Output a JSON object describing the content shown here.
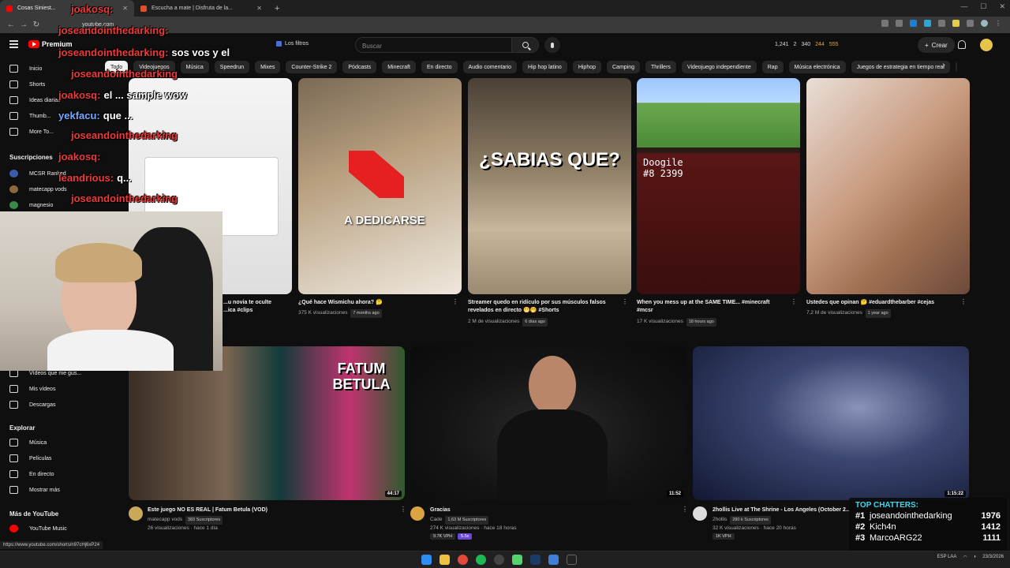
{
  "browser": {
    "tabs": [
      {
        "label": "Cosas Siniest...",
        "active": true
      },
      {
        "label": "Escucha a mate | Disfruta de la...",
        "active": false
      }
    ],
    "new_tab": "+",
    "url": "youtube.com",
    "status_url": "https://www.youtube.com/shorts/n97cHj6xP24"
  },
  "header": {
    "logo_text": "Premium",
    "filters_label": "Los filtros",
    "search_placeholder": "Buscar",
    "stats": [
      "1,241",
      "2",
      "340",
      "244",
      "555"
    ],
    "create_label": "Crear"
  },
  "chips": [
    "Todo",
    "Videojuegos",
    "Música",
    "Speedrun",
    "Mixes",
    "Counter-Strike 2",
    "Pódcasts",
    "Minecraft",
    "En directo",
    "Audio comentario",
    "Hip hop latino",
    "Hiphop",
    "Camping",
    "Thrillers",
    "Videojuego independiente",
    "Rap",
    "Música electrónica",
    "Juegos de estrategia en tiempo real",
    "Subid"
  ],
  "sidebar": {
    "items": [
      "Inicio",
      "Shorts",
      "Ideas diarias",
      "Thumb...",
      "More To..."
    ],
    "subs_header": "Suscripciones",
    "subs": [
      "MCSR Ranked",
      "matecapp vods",
      "magnesio"
    ],
    "you_items": [
      "Vídeos que me gus...",
      "Mis vídeos",
      "Descargas"
    ],
    "explore_header": "Explorar",
    "explore_items": [
      "Música",
      "Películas",
      "En directo",
      "Mostrar más"
    ],
    "more_header": "Más de YouTube",
    "more_items": [
      "YouTube Music"
    ]
  },
  "shorts": [
    {
      "title": "...u novia te oculte\n...ica #clips",
      "meta": ""
    },
    {
      "title": "¿Qué hace Wismichu ahora? 🤔",
      "views": "375 K visualizaciones",
      "age": "7 months ago",
      "overlay": "A DEDICARSE"
    },
    {
      "title": "Streamer quedo en ridículo por sus músculos falsos revelados en directo 😁🤭 #Shorts",
      "views": "2 M de visualizaciones",
      "age": "6 días ago",
      "overlay": "¿SABIAS QUE?"
    },
    {
      "title": "When you mess up at the SAME TIME... #minecraft #mcsr",
      "views": "17 K visualizaciones",
      "age": "18 hours ago",
      "overlay_a": "Doogile",
      "overlay_b": "#8 2399"
    },
    {
      "title": "Ustedes que opinan 🤔 #eduardthebarber #cejas",
      "views": "7,2 M de visualizaciones",
      "age": "1 year ago"
    }
  ],
  "videos": [
    {
      "title": "Este juego NO ES REAL | Fatum Betula (VOD)",
      "channel": "matecapp vods",
      "subs": "383 Suscriptores",
      "meta": "26 visualizaciones · hace 1 día",
      "duration": "44:17",
      "overlay": "FATUM BETULA"
    },
    {
      "title": "Gracias",
      "channel": "Cade",
      "subs": "1,63 M Suscriptores",
      "meta": "274 K visualizaciones · hace 18 horas",
      "duration": "11:52",
      "vpm": "9.7K VPH",
      "pill": "5.5x"
    },
    {
      "title": "2hollis Live at The Shrine - Los Angeles (October 2...",
      "channel": "2hollis",
      "subs": "280 k Suscriptores",
      "meta": "32 K visualizaciones · hace 20 horas",
      "duration": "1:15:22",
      "vpm": "1K VPH"
    }
  ],
  "chat": [
    {
      "user": "joakosq:",
      "msg": "",
      "color": "red"
    },
    {
      "user": "joseandointhedarking:",
      "msg": "",
      "color": "red"
    },
    {
      "user": "joseandointhedarking:",
      "msg": "sos vos y el",
      "color": "red"
    },
    {
      "user": "joseandointhedarking",
      "msg": "",
      "color": "red"
    },
    {
      "user": "joakosq:",
      "msg": "el ... sample wow",
      "color": "red"
    },
    {
      "user": "yekfacu:",
      "msg": "que ...",
      "color": "blue"
    },
    {
      "user": "joseandointhedarking",
      "msg": "",
      "color": "red"
    },
    {
      "user": "joakosq:",
      "msg": "",
      "color": "red"
    },
    {
      "user": "leandrious:",
      "msg": "q...",
      "color": "red"
    },
    {
      "user": "joseandointhedarking",
      "msg": "",
      "color": "red"
    }
  ],
  "top_chatters": {
    "title": "TOP CHATTERS:",
    "rows": [
      {
        "rank": "#1",
        "name": "joseandointhedarking",
        "count": "1976"
      },
      {
        "rank": "#2",
        "name": "Kich4n",
        "count": "1412"
      },
      {
        "rank": "#3",
        "name": "MarcoARG22",
        "count": "1111"
      }
    ]
  },
  "taskbar": {
    "lang": "ESP LAA",
    "date": "23/3/2026"
  }
}
